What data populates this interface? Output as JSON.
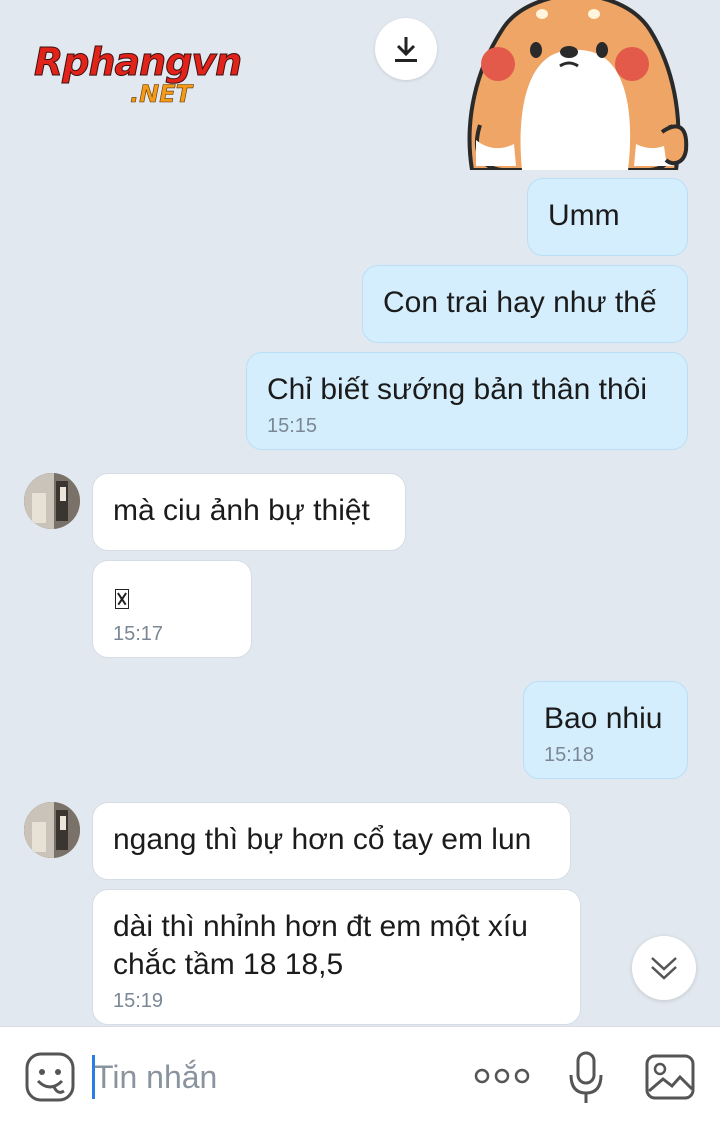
{
  "watermark": {
    "main": "Rphangvn",
    "sub": ".NET"
  },
  "messages": [
    {
      "id": "m1",
      "dir": "out",
      "text": "Umm",
      "time": ""
    },
    {
      "id": "m2",
      "dir": "out",
      "text": "Con trai hay như thế",
      "time": ""
    },
    {
      "id": "m3",
      "dir": "out",
      "text": "Chỉ biết sướng bản thân thôi",
      "time": "15:15"
    },
    {
      "id": "m4",
      "dir": "in",
      "text": "mà ciu ảnh bự thiệt",
      "time": ""
    },
    {
      "id": "m5",
      "dir": "in",
      "text": "",
      "time": "15:17"
    },
    {
      "id": "m6",
      "dir": "out",
      "text": "Bao nhiu",
      "time": "15:18"
    },
    {
      "id": "m7",
      "dir": "in",
      "text": "ngang thì bự hơn cổ tay em lun",
      "time": ""
    },
    {
      "id": "m8",
      "dir": "in",
      "text_line1": "dài thì nhỉnh hơn đt em một xíu",
      "text_line2": "chắc tầm 18 18,5",
      "time": "15:19"
    }
  ],
  "input": {
    "placeholder": "Tin nhắn"
  },
  "icons": {
    "download": "download-icon",
    "scroll_down": "chevron-double-down-icon",
    "emoji": "sticker-smiley-icon",
    "more": "more-dots-icon",
    "mic": "microphone-icon",
    "image": "image-icon"
  },
  "colors": {
    "background": "#e2e8f0",
    "outgoing_bubble": "#d5eefd",
    "incoming_bubble": "#ffffff",
    "timestamp": "#7b8794",
    "caret": "#2a7de1"
  }
}
